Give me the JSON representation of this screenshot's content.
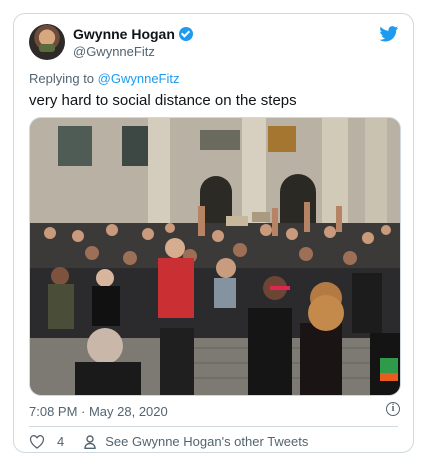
{
  "tweet": {
    "author": {
      "name": "Gwynne Hogan",
      "handle": "@GwynneFitz",
      "verified": true,
      "avatar_icon": "profile-photo"
    },
    "reply_to": {
      "prefix": "Replying to ",
      "mention": "@GwynneFitz"
    },
    "text": "very hard to social distance on the steps",
    "media": {
      "type": "photo"
    },
    "timestamp": "7:08 PM · May 28, 2020",
    "likes": "4",
    "other_tweets_link": "See Gwynne Hogan's other Tweets"
  },
  "icons": {
    "brand": "twitter-bird-icon",
    "verified": "verified-badge-icon",
    "info": "info-icon",
    "like": "heart-icon",
    "profile": "person-icon"
  },
  "colors": {
    "accent": "#1d9bf0",
    "text_primary": "#0f1419",
    "text_secondary": "#536471",
    "border": "#cfd9de"
  }
}
